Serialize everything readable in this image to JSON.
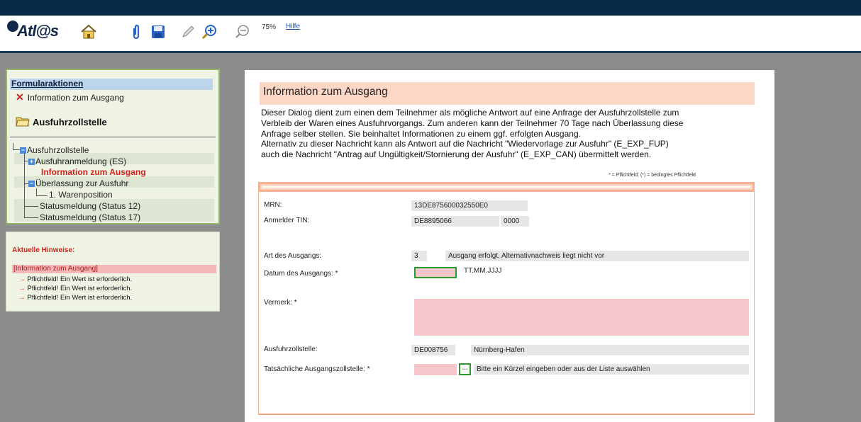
{
  "toolbar": {
    "logo_text": "Atl@s",
    "zoom": "75%",
    "help_label": "Hilfe"
  },
  "sidebar": {
    "actions_title": "Formularaktionen",
    "actions_item": "Information zum Ausgang",
    "office_title": "Ausfuhrzollstelle",
    "tree": [
      {
        "label": "Ausfuhrzollstelle"
      },
      {
        "label": "Ausfuhranmeldung (ES)"
      },
      {
        "label": "Information zum Ausgang"
      },
      {
        "label": "Überlassung zur Ausfuhr"
      },
      {
        "label": "1. Warenposition"
      },
      {
        "label": "Statusmeldung (Status 12)"
      },
      {
        "label": "Statusmeldung (Status 17)"
      }
    ]
  },
  "hints": {
    "title": "Aktuelle Hinweise:",
    "head": "[Information zum Ausgang]",
    "items": [
      "Pflichtfeld! Ein Wert ist erforderlich.",
      "Pflichtfeld! Ein Wert ist erforderlich.",
      "Pflichtfeld! Ein Wert ist erforderlich."
    ]
  },
  "document": {
    "title": "Information zum Ausgang",
    "description_lines": [
      "Dieser Dialog dient zum einen dem Teilnehmer als mögliche Antwort auf eine Anfrage der Ausfuhrzollstelle zum",
      "Verbleib der Waren eines Ausfuhrvorgangs. Zum anderen kann der Teilnehmer 70 Tage nach Überlassung diese",
      "Anfrage selber stellen. Sie beinhaltet Informationen zu einem ggf. erfolgten Ausgang.",
      "Alternativ zu dieser Nachricht kann als Antwort auf die Nachricht \"Wiedervorlage zur Ausfuhr\" (E_EXP_FUP)",
      "auch die Nachricht \"Antrag auf Ungültigkeit/Stornierung der Ausfuhr\" (E_EXP_CAN) übermittelt werden."
    ],
    "legend": "* = Pflichtfeld; (*) = bedingtes Pflichtfeld"
  },
  "form": {
    "mrn_label": "MRN:",
    "mrn_value": "13DE875600032550E0",
    "tin_label": "Anmelder TIN:",
    "tin_value": "DE8895066",
    "tin_suffix": "0000",
    "art_label": "Art des Ausgangs:",
    "art_code": "3",
    "art_text": "Ausgang erfolgt, Alternativnachweis liegt nicht vor",
    "datum_label": "Datum des Ausgangs: *",
    "datum_value": "",
    "datum_format": "TT.MM.JJJJ",
    "vermerk_label": "Vermerk: *",
    "vermerk_value": "",
    "office_label": "Ausfuhrzollstelle:",
    "office_code": "DE008756",
    "office_name": "Nürnberg-Hafen",
    "actual_label": "Tatsächliche Ausgangszollstelle: *",
    "actual_value": "",
    "actual_pick": "...",
    "actual_hint": "Bitte ein Kürzel eingeben oder aus der Liste auswählen"
  }
}
